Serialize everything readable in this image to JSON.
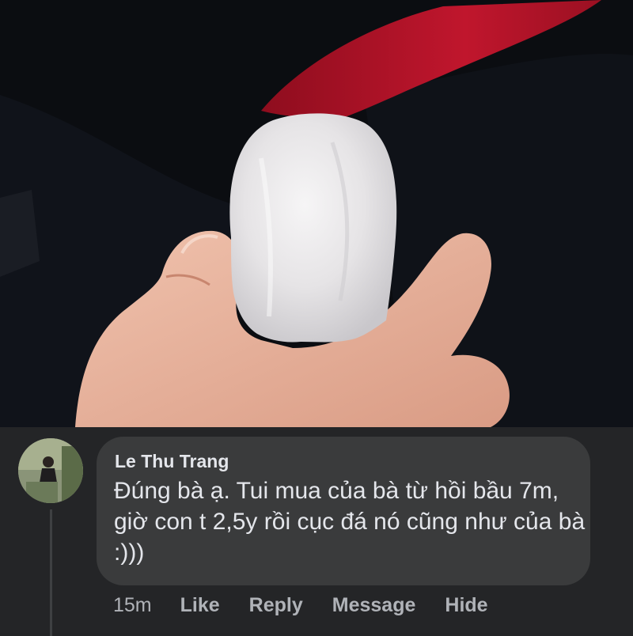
{
  "photo": {
    "subject": "hand holding ice cube",
    "colors": {
      "background": "#0c0e12",
      "fabric_red": "#b5152a",
      "skin": "#e9b8a3",
      "ice": "#e8e7e8"
    }
  },
  "comment": {
    "author": "Le Thu Trang",
    "text": "Đúng bà ạ. Tui mua của bà từ hồi bầu 7m, giờ con t 2,5y rồi cục đá nó cũng như của bà :)))",
    "time": "15m",
    "actions": {
      "like": "Like",
      "reply": "Reply",
      "message": "Message",
      "hide": "Hide"
    }
  },
  "theme": {
    "bubble_bg": "#3a3b3c",
    "text_primary": "#e4e6eb",
    "text_secondary": "#b0b3b8",
    "page_bg": "#242527"
  }
}
